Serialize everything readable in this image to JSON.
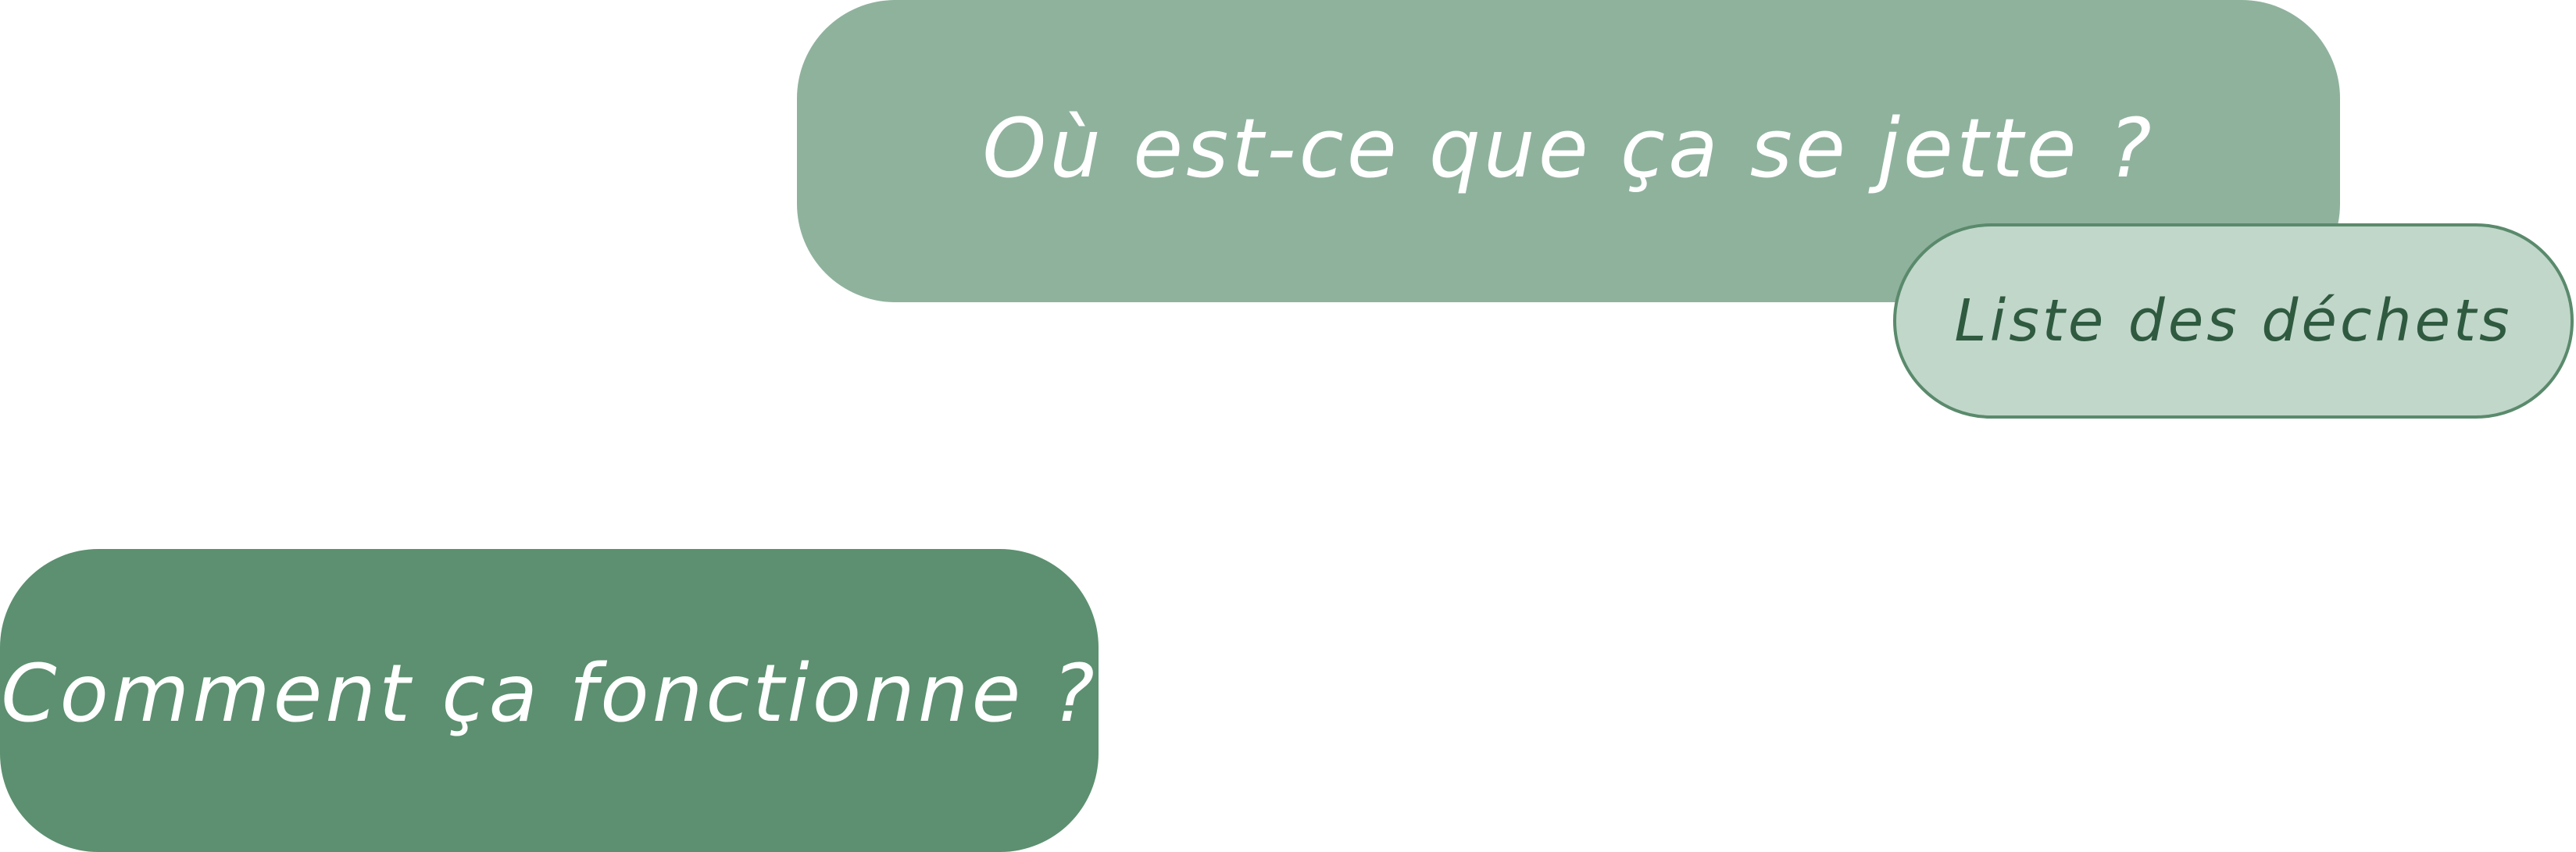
{
  "buttons": {
    "where": {
      "label": "Où est-ce que ça se jette ?",
      "color": "#8fb29d"
    },
    "list": {
      "label": "Liste des déchets",
      "color": "#c1d7ca",
      "border_color": "#5a8a6c",
      "text_color": "#2f5a40"
    },
    "how": {
      "label": "Comment ça fonctionne ?",
      "color": "#5c9070"
    }
  }
}
